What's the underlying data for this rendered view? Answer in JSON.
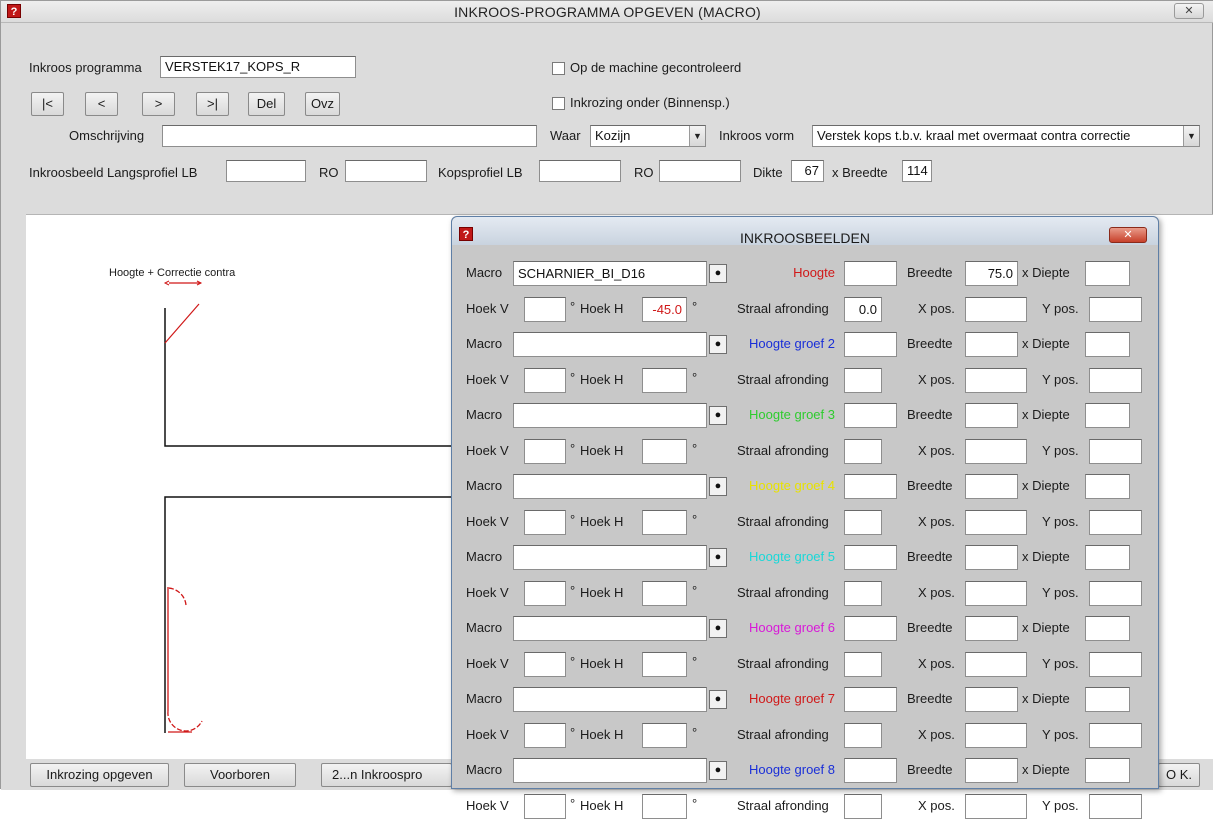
{
  "window": {
    "title": "INKROOS-PROGRAMMA OPGEVEN (MACRO)",
    "close_label": "✕",
    "icon_glyph": "?"
  },
  "top": {
    "program_label": "Inkroos programma",
    "program_value": "VERSTEK17_KOPS_R",
    "nav": [
      "|<",
      "<",
      ">",
      ">|",
      "Del",
      "Ovz"
    ],
    "checkbox1": "Op de machine gecontroleerd",
    "checkbox2": "Inkrozing onder (Binnensp.)",
    "omschrijving_label": "Omschrijving",
    "omschrijving_value": "",
    "waar_label": "Waar",
    "waar_value": "Kozijn",
    "vorm_label": "Inkroos vorm",
    "vorm_value": "Verstek kops t.b.v. kraal met overmaat contra correctie",
    "langs_label": "Inkroosbeeld Langsprofiel LB",
    "ro1_label": "RO",
    "kops_label": "Kopsprofiel LB",
    "ro2_label": "RO",
    "dikte_label": "Dikte",
    "dikte_value": "67",
    "breedte_label": "x Breedte",
    "breedte_value": "114"
  },
  "canvas": {
    "annotation": "Hoogte + Correctie contra"
  },
  "bottom": {
    "btn1": "Inkrozing opgeven",
    "btn2": "Voorboren",
    "btn3": "2...n  Inkroospro",
    "ok": "O K."
  },
  "dialog": {
    "title": "INKROOSBEELDEN",
    "labels": {
      "macro": "Macro",
      "breedte": "Breedte",
      "diepte": "x Diepte",
      "hoek_v": "Hoek V",
      "deg": "°",
      "hoek_h": "Hoek H",
      "straal": "Straal afronding",
      "xpos": "X pos.",
      "ypos": "Y pos."
    },
    "groups": [
      {
        "macro": "SCHARNIER_BI_D16",
        "hoogte_label": "Hoogte",
        "hoogte_color": "#d01818",
        "breedte": "75.0",
        "hoek_h": "-45.0",
        "straal": "0.0"
      },
      {
        "macro": "",
        "hoogte_label": "Hoogte groef 2",
        "hoogte_color": "#1a2fd8",
        "breedte": "",
        "hoek_h": "",
        "straal": ""
      },
      {
        "macro": "",
        "hoogte_label": "Hoogte groef 3",
        "hoogte_color": "#2ecc2e",
        "breedte": "",
        "hoek_h": "",
        "straal": ""
      },
      {
        "macro": "",
        "hoogte_label": "Hoogte groef 4",
        "hoogte_color": "#e8e200",
        "breedte": "",
        "hoek_h": "",
        "straal": ""
      },
      {
        "macro": "",
        "hoogte_label": "Hoogte groef 5",
        "hoogte_color": "#18d8d8",
        "breedte": "",
        "hoek_h": "",
        "straal": ""
      },
      {
        "macro": "",
        "hoogte_label": "Hoogte groef 6",
        "hoogte_color": "#d818d8",
        "breedte": "",
        "hoek_h": "",
        "straal": ""
      },
      {
        "macro": "",
        "hoogte_label": "Hoogte groef 7",
        "hoogte_color": "#d01818",
        "breedte": "",
        "hoek_h": "",
        "straal": ""
      },
      {
        "macro": "",
        "hoogte_label": "Hoogte groef 8",
        "hoogte_color": "#1a2fd8",
        "breedte": "",
        "hoek_h": "",
        "straal": ""
      }
    ]
  },
  "colors": {
    "drawing_black": "#111111",
    "drawing_red": "#d01818",
    "negative_value": "#d01818"
  }
}
